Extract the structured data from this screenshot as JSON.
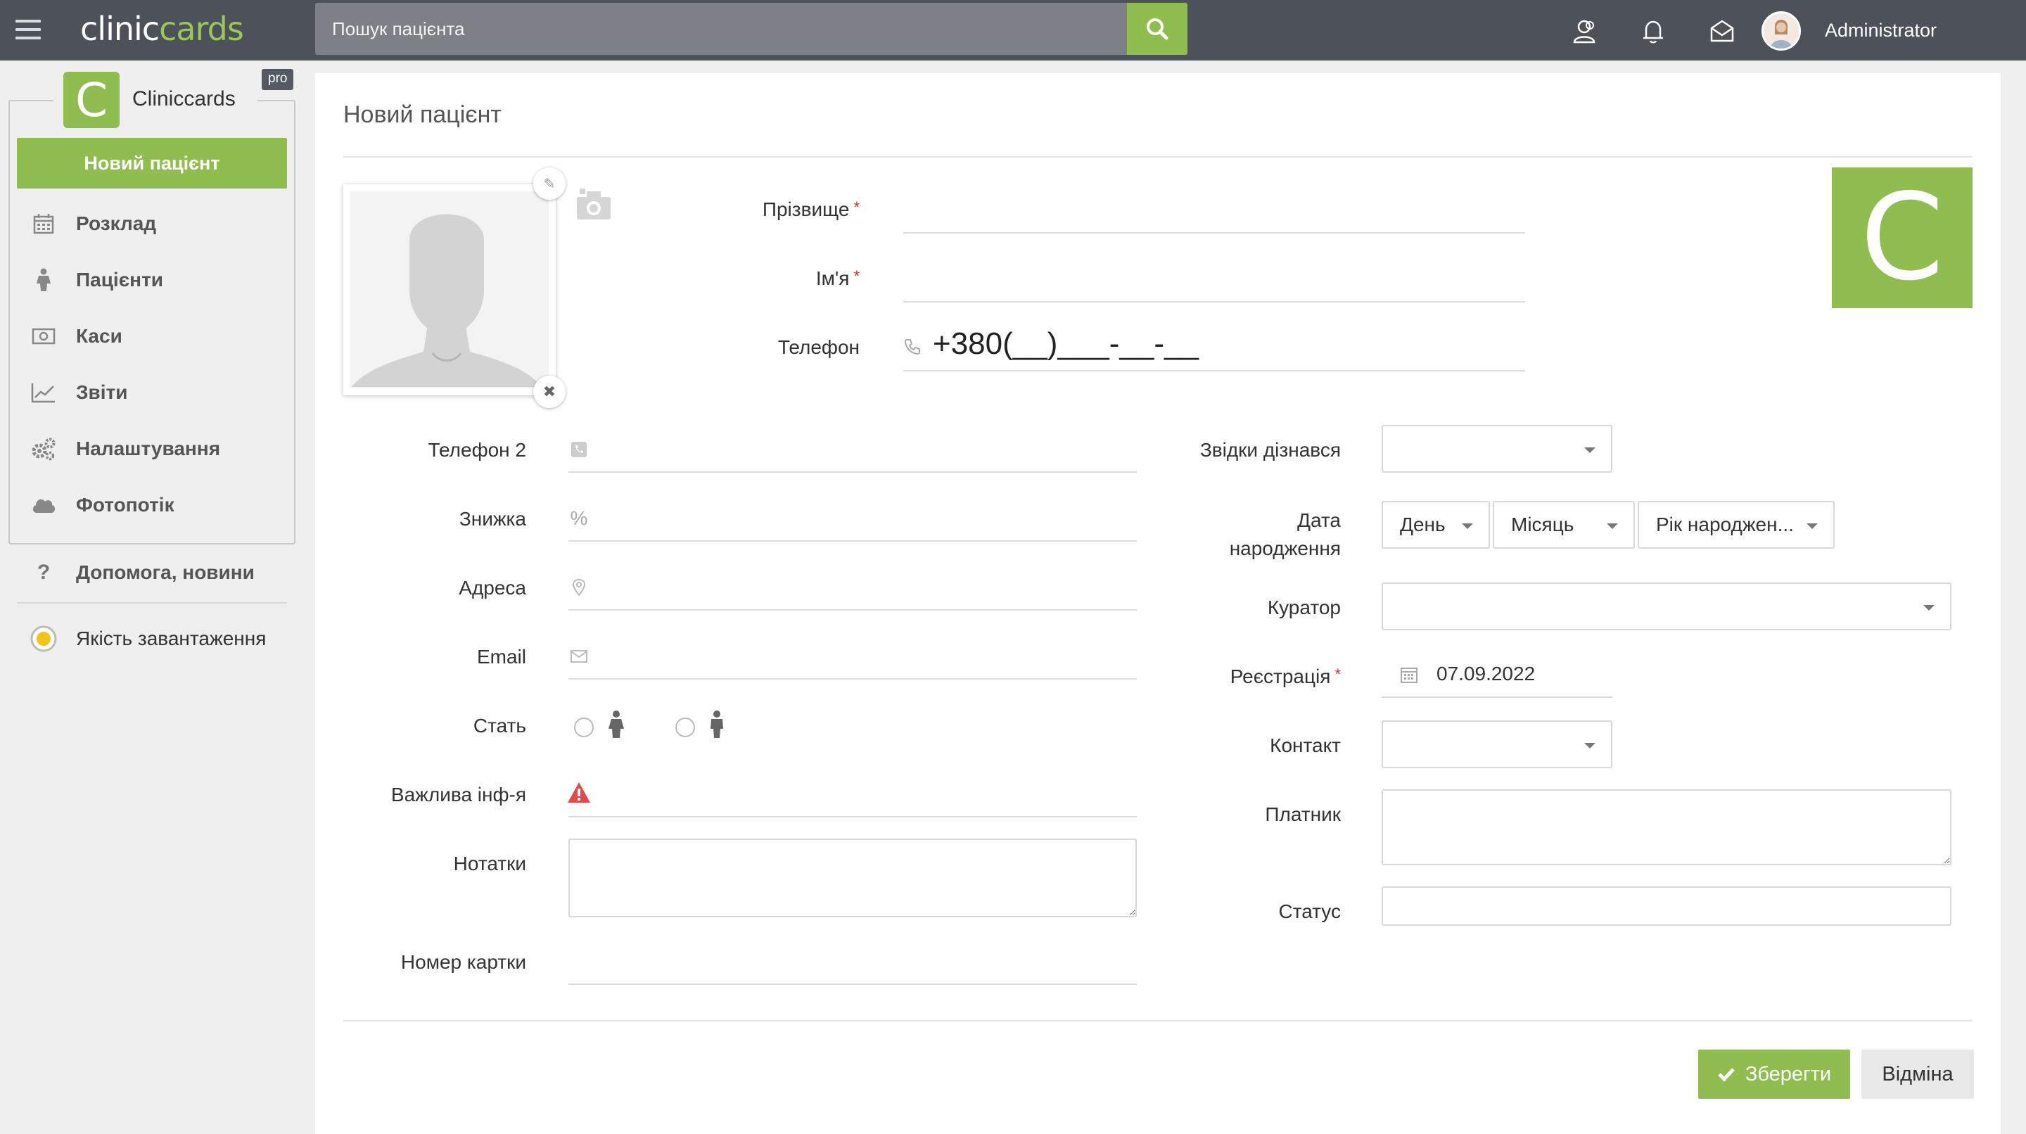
{
  "topbar": {
    "logo_part1": "clinic",
    "logo_part2": "cards",
    "search_placeholder": "Пошук пацієнта",
    "user_name": "Administrator",
    "icons": [
      "users-icon",
      "bell-icon",
      "mail-icon"
    ]
  },
  "sidebar": {
    "badge_letter": "C",
    "brand": "Cliniccards",
    "pro_badge": "pro",
    "new_patient": "Новий пацієнт",
    "items": [
      {
        "label": "Розклад",
        "icon": "calendar-icon"
      },
      {
        "label": "Пацієнти",
        "icon": "patient-icon"
      },
      {
        "label": "Каси",
        "icon": "cash-icon"
      },
      {
        "label": "Звіти",
        "icon": "chart-icon"
      },
      {
        "label": "Налаштування",
        "icon": "gears-icon"
      },
      {
        "label": "Фотопотік",
        "icon": "cloud-icon"
      }
    ],
    "help": "Допомога, новини",
    "quality": "Якість завантаження"
  },
  "form": {
    "title": "Новий пацієнт",
    "logo_letter": "C",
    "surname_label": "Прізвище",
    "name_label": "Ім'я",
    "phone_label": "Телефон",
    "phone_value": "+380(__)___-__-__",
    "phone2_label": "Телефон 2",
    "discount_label": "Знижка",
    "address_label": "Адреса",
    "email_label": "Email",
    "gender_label": "Стать",
    "important_label": "Важлива інф-я",
    "notes_label": "Нотатки",
    "card_number_label": "Номер картки",
    "source_label": "Звідки дізнався",
    "birth_label_line1": "Дата",
    "birth_label_line2": "народження",
    "birth_day": "День",
    "birth_month": "Місяць",
    "birth_year": "Рік народжен...",
    "curator_label": "Куратор",
    "registration_label": "Реєстрація",
    "registration_value": "07.09.2022",
    "contact_label": "Контакт",
    "payer_label": "Платник",
    "status_label": "Статус",
    "save": "Зберегти",
    "cancel": "Відміна"
  }
}
